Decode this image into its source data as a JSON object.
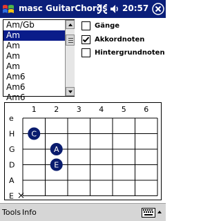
{
  "titlebar": {
    "title": "masc GuitarChords",
    "clock": "20:57",
    "background": "#0b1f7a"
  },
  "chord_list": {
    "selected_index": 1,
    "items": [
      "Am/Gb",
      "Am",
      "Am",
      "Am",
      "Am",
      "Am6",
      "Am6",
      "Am6"
    ]
  },
  "options": [
    {
      "label": "Gänge",
      "checked": false
    },
    {
      "label": "Akkordnoten",
      "checked": true
    },
    {
      "label": "Hintergrundnoten",
      "checked": false
    }
  ],
  "fretboard": {
    "fret_numbers": [
      "1",
      "2",
      "3",
      "4",
      "5",
      "6"
    ],
    "strings": [
      "e",
      "H",
      "G",
      "D",
      "A",
      "E"
    ],
    "markers": [
      {
        "string": "H",
        "fret": 1,
        "note": "C"
      },
      {
        "string": "G",
        "fret": 2,
        "note": "A"
      },
      {
        "string": "D",
        "fret": 2,
        "note": "E"
      }
    ],
    "muted_strings": [
      "E"
    ],
    "marker_color": "#0a1c6e"
  },
  "menu": {
    "tools": "Tools",
    "info": "Info"
  }
}
